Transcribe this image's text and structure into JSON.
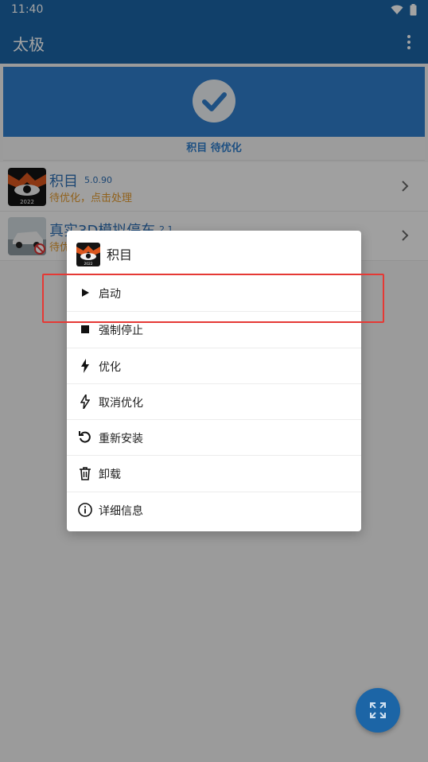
{
  "status": {
    "time": "11:40"
  },
  "appbar": {
    "title": "太极"
  },
  "banner": {
    "status_text": "积目 待优化"
  },
  "apps": [
    {
      "name": "积目",
      "version": "5.0.90",
      "status": "待优化，点击处理"
    },
    {
      "name": "真实3D模拟停车",
      "version": "2.1",
      "status": "待优化"
    }
  ],
  "dialog": {
    "title": "积目",
    "items": [
      {
        "label": "启动",
        "icon": "play-icon"
      },
      {
        "label": "强制停止",
        "icon": "stop-icon"
      },
      {
        "label": "优化",
        "icon": "bolt-icon"
      },
      {
        "label": "取消优化",
        "icon": "bolt-off-icon"
      },
      {
        "label": "重新安装",
        "icon": "reload-icon"
      },
      {
        "label": "卸载",
        "icon": "trash-icon"
      },
      {
        "label": "详细信息",
        "icon": "info-icon"
      }
    ]
  },
  "app_icon_badge": "2022",
  "colors": {
    "primary": "#1c65a6",
    "accent": "#2f7dcb",
    "warning": "#e39a2e",
    "highlight": "#e53935"
  }
}
